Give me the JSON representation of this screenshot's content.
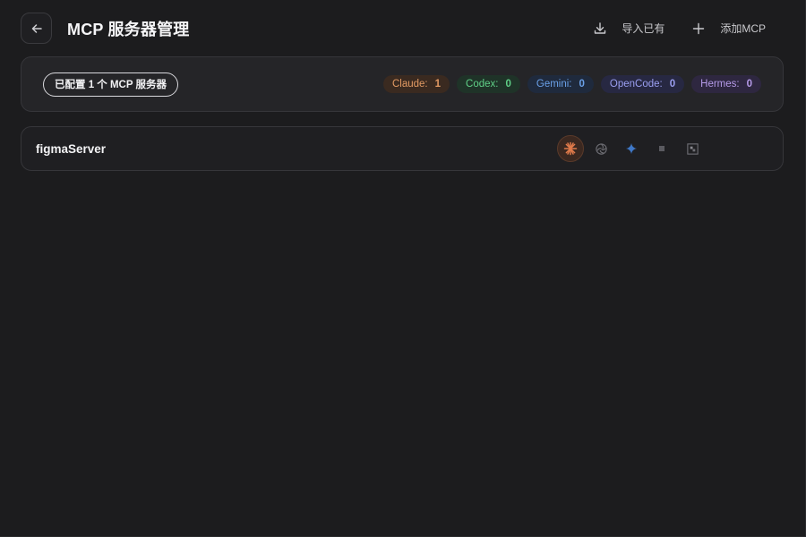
{
  "header": {
    "title": "MCP 服务器管理",
    "import_label": "导入已有",
    "add_label": "添加MCP"
  },
  "summary": {
    "count_label": "已配置 1 个 MCP 服务器",
    "apps": [
      {
        "name": "Claude:",
        "count": "1",
        "color": "#e29a63",
        "bg": "#3a2a20"
      },
      {
        "name": "Codex:",
        "count": "0",
        "color": "#5fcf86",
        "bg": "#1f3328"
      },
      {
        "name": "Gemini:",
        "count": "0",
        "color": "#6aa0e8",
        "bg": "#1f2a3d"
      },
      {
        "name": "OpenCode:",
        "count": "0",
        "color": "#9a9ef0",
        "bg": "#272842"
      },
      {
        "name": "Hermes:",
        "count": "0",
        "color": "#b59ae8",
        "bg": "#2e2740"
      }
    ]
  },
  "servers": [
    {
      "name": "figmaServer",
      "agents": [
        {
          "icon": "claude-icon",
          "active": true
        },
        {
          "icon": "openai-icon",
          "active": false
        },
        {
          "icon": "gemini-icon",
          "active": false
        },
        {
          "icon": "opencode-icon",
          "active": false
        },
        {
          "icon": "hermes-icon",
          "active": false
        }
      ]
    }
  ]
}
